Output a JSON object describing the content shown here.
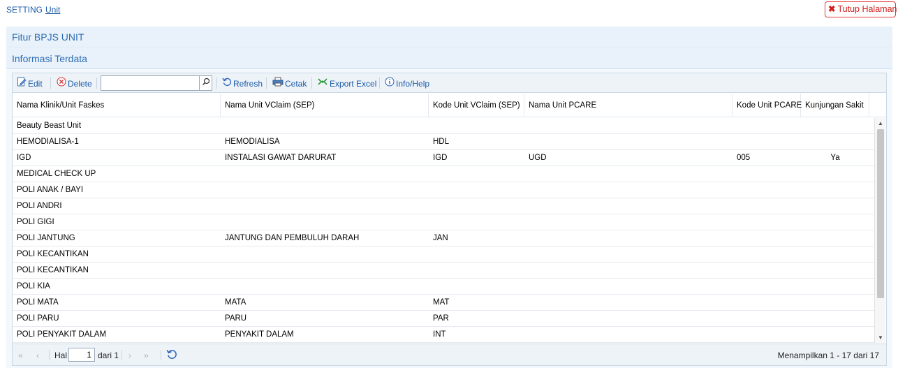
{
  "breadcrumb": {
    "setting": "SETTING",
    "unit": "Unit"
  },
  "close_button": "Tutup Halaman",
  "sections": {
    "title1": "Fitur BPJS UNIT",
    "title2": "Informasi Terdata"
  },
  "toolbar": {
    "edit": "Edit",
    "delete": "Delete",
    "search_value": "",
    "refresh": "Refresh",
    "print": "Cetak",
    "export": "Export Excel",
    "info": "Info/Help"
  },
  "columns": [
    "Nama Klinik/Unit Faskes",
    "Nama Unit VClaim (SEP)",
    "Kode Unit VClaim (SEP)",
    "Nama Unit PCARE",
    "Kode Unit PCARE",
    "Kunjungan Sakit"
  ],
  "rows": [
    [
      "Beauty Beast Unit",
      "",
      "",
      "",
      "",
      ""
    ],
    [
      "HEMODIALISA-1",
      "HEMODIALISA",
      "HDL",
      "",
      "",
      ""
    ],
    [
      "IGD",
      "INSTALASI GAWAT DARURAT",
      "IGD",
      "UGD",
      "005",
      "Ya"
    ],
    [
      "MEDICAL CHECK UP",
      "",
      "",
      "",
      "",
      ""
    ],
    [
      "POLI ANAK / BAYI",
      "",
      "",
      "",
      "",
      ""
    ],
    [
      "POLI ANDRI",
      "",
      "",
      "",
      "",
      ""
    ],
    [
      "POLI GIGI",
      "",
      "",
      "",
      "",
      ""
    ],
    [
      "POLI JANTUNG",
      "JANTUNG DAN PEMBULUH DARAH",
      "JAN",
      "",
      "",
      ""
    ],
    [
      "POLI KECANTIKAN",
      "",
      "",
      "",
      "",
      ""
    ],
    [
      "POLI KECANTIKAN",
      "",
      "",
      "",
      "",
      ""
    ],
    [
      "POLI KIA",
      "",
      "",
      "",
      "",
      ""
    ],
    [
      "POLI MATA",
      "MATA",
      "MAT",
      "",
      "",
      ""
    ],
    [
      "POLI PARU",
      "PARU",
      "PAR",
      "",
      "",
      ""
    ],
    [
      "POLI PENYAKIT DALAM",
      "PENYAKIT DALAM",
      "INT",
      "",
      "",
      ""
    ]
  ],
  "pager": {
    "hal_label": "Hal",
    "page": "1",
    "of_label": "dari 1",
    "summary": "Menampilkan 1 - 17 dari 17"
  },
  "colors": {
    "accent": "#1a5aa8",
    "danger": "#d21f1f",
    "panel": "#f3f8fd"
  }
}
